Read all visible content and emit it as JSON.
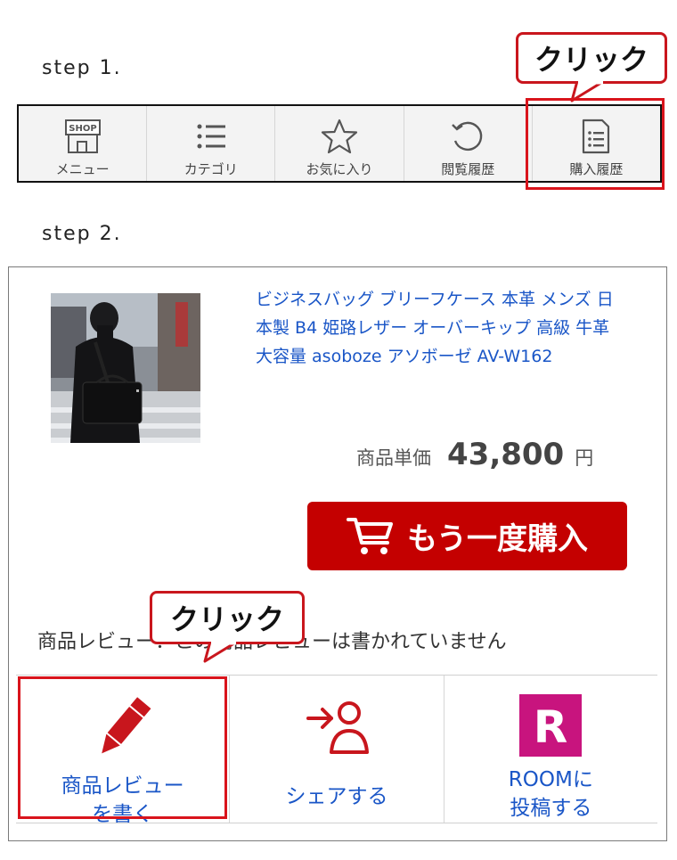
{
  "steps": {
    "step1": "step 1.",
    "step2": "step 2."
  },
  "callouts": {
    "top": "クリック",
    "bottom": "クリック"
  },
  "nav": {
    "items": [
      {
        "label": "メニュー",
        "icon": "shop-icon"
      },
      {
        "label": "カテゴリ",
        "icon": "list-icon"
      },
      {
        "label": "お気に入り",
        "icon": "star-icon"
      },
      {
        "label": "閲覧履歴",
        "icon": "history-icon"
      },
      {
        "label": "購入履歴",
        "icon": "receipt-icon"
      }
    ],
    "shop_badge": "SHOP"
  },
  "product": {
    "title": "ビジネスバッグ ブリーフケース 本革 メンズ 日本製 B4 姫路レザー オーバーキップ 高級 牛革 大容量 asoboze アソボーゼ AV-W162",
    "price_label": "商品単価",
    "price_value": "43,800",
    "price_unit": "円",
    "buy_again": "もう一度購入"
  },
  "review": {
    "status": "商品レビュー：この商品レビューは書かれていません"
  },
  "actions": [
    {
      "label_line1": "商品レビュー",
      "label_line2": "を書く",
      "icon": "pencil-icon"
    },
    {
      "label_line1": "シェアする",
      "label_line2": "",
      "icon": "share-user-icon"
    },
    {
      "label_line1": "ROOMに",
      "label_line2": "投稿する",
      "icon": "room-logo-icon"
    }
  ],
  "room_logo_letter": "R",
  "colors": {
    "accent_red": "#c40000",
    "highlight_red": "#d9141c",
    "link_blue": "#1a56c7",
    "room_pink": "#c8147e"
  }
}
